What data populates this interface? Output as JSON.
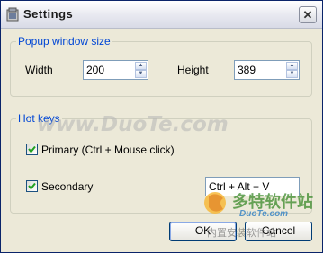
{
  "window": {
    "title": "Settings",
    "close_glyph": "✕",
    "app_icon": "settings-app-icon"
  },
  "popup_size": {
    "group_title": "Popup window size",
    "width_label": "Width",
    "width_value": "200",
    "height_label": "Height",
    "height_value": "389"
  },
  "hot_keys": {
    "group_title": "Hot keys",
    "primary_label": "Primary (Ctrl + Mouse click)",
    "primary_checked": true,
    "secondary_label": "Secondary",
    "secondary_checked": true,
    "secondary_value": "Ctrl + Alt + V"
  },
  "buttons": {
    "ok": "OK",
    "cancel": "Cancel"
  },
  "watermark": {
    "main": "www.DuoTe.com",
    "logo_cn": "多特软件站",
    "logo_url": "DuoTe.com",
    "overlay_cn": "内置安装软件站"
  },
  "colors": {
    "group_title": "#0046d5",
    "window_bg": "#ece9d8",
    "border": "#7f9db9"
  }
}
